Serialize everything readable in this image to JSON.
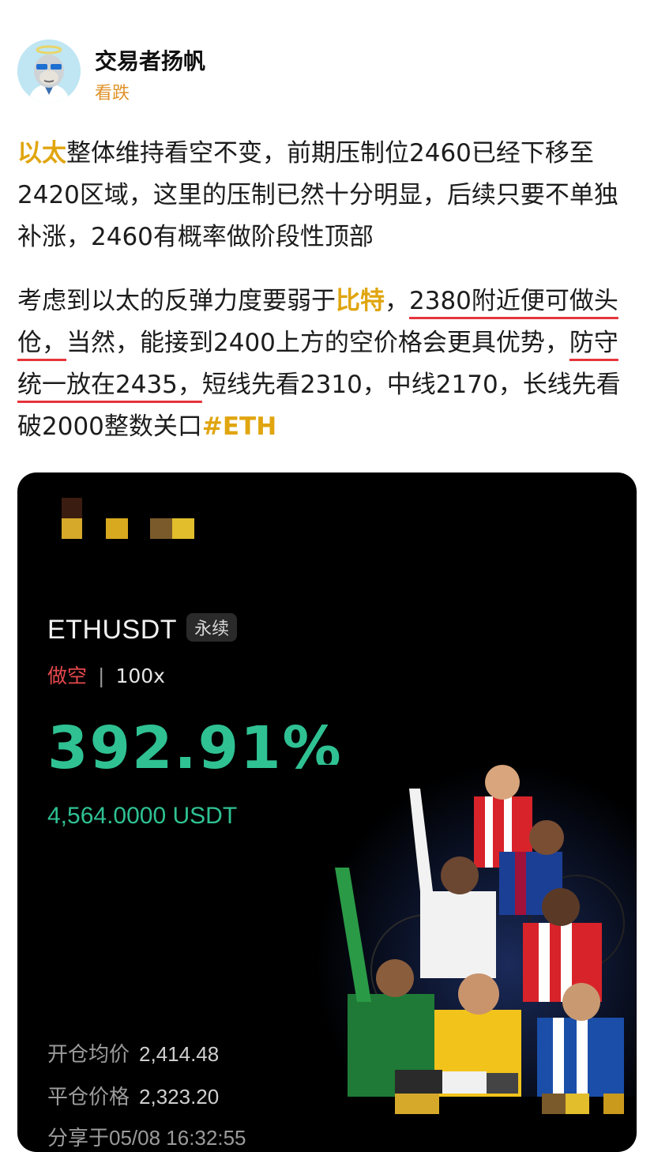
{
  "author": {
    "name": "交易者扬帆",
    "subtitle": "看跌"
  },
  "post": {
    "p1": {
      "hl_eth": "以太",
      "text": "整体维持看空不变，前期压制位2460已经下移至2420区域，这里的压制已然十分明显，后续只要不单独补涨，2460有概率做阶段性顶部"
    },
    "p2": {
      "t1": "考虑到以太的反弹力度要弱于",
      "hl_btc": "比特",
      "t2": "，",
      "u1": "2380附近便可做头伧，",
      "t3": "当然，能接到2400上方的空价格会更具优势，",
      "u2": "防守统一放在2435，",
      "t4": "短线先看2310，中线2170，长线先看破2000整数关口",
      "tag": "#ETH"
    }
  },
  "card": {
    "pair": "ETHUSDT",
    "badge": "永续",
    "side": "做空",
    "leverage": "100x",
    "roi": "392.91%",
    "pnl": "4,564.0000 USDT",
    "open_label": "开仓均价",
    "open_value": "2,414.48",
    "close_label": "平仓价格",
    "close_value": "2,323.20",
    "shared": "分享于05/08 16:32:55",
    "colors": {
      "profit": "#2fc192",
      "short": "#e5484d",
      "highlight": "#e0a50f"
    }
  }
}
